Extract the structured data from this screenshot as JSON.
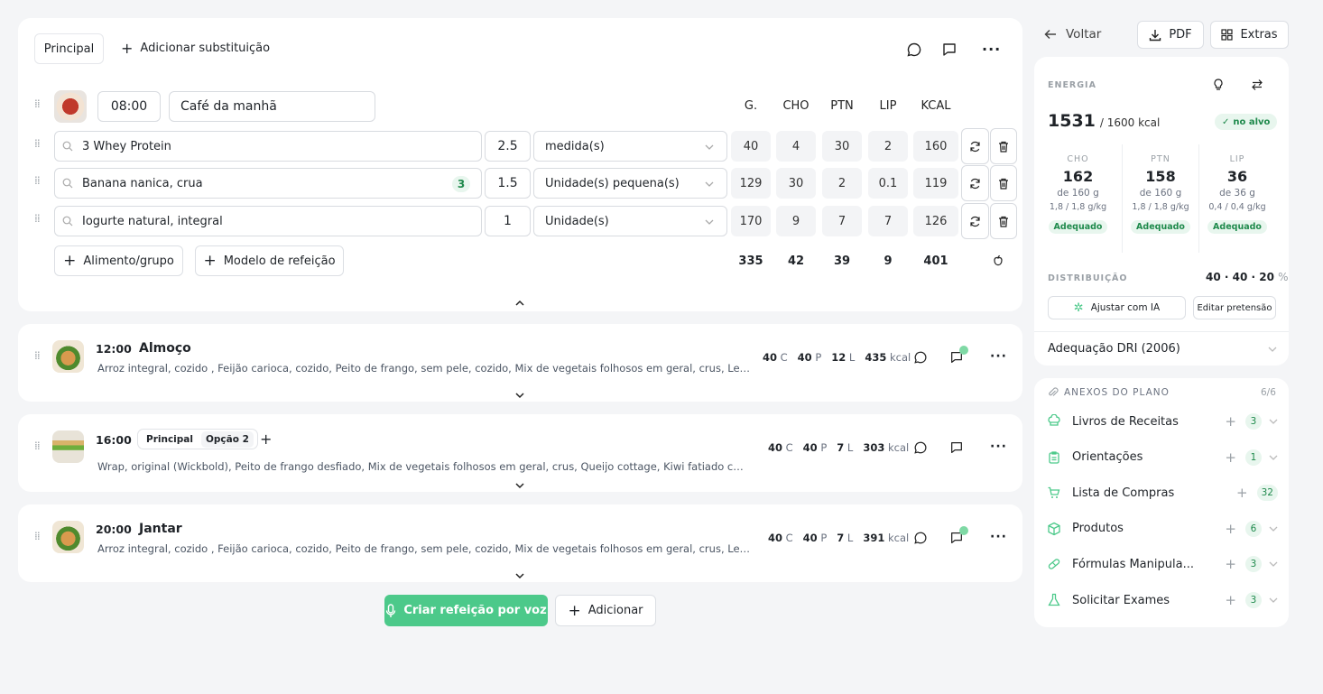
{
  "header": {
    "tab_principal": "Principal",
    "add_substitution": "Adicionar substituição"
  },
  "breakfast": {
    "time": "08:00",
    "name": "Café da manhã",
    "columns": [
      "G.",
      "CHO",
      "PTN",
      "LIP",
      "KCAL"
    ],
    "foods": [
      {
        "name": "3 Whey Protein",
        "badge": "",
        "qty": "2.5",
        "unit": "medida(s)",
        "g": "40",
        "cho": "4",
        "ptn": "30",
        "lip": "2",
        "kcal": "160"
      },
      {
        "name": "Banana nanica, crua",
        "badge": "3",
        "qty": "1.5",
        "unit": "Unidade(s) pequena(s)",
        "g": "129",
        "cho": "30",
        "ptn": "2",
        "lip": "0.1",
        "kcal": "119"
      },
      {
        "name": "Iogurte natural, integral",
        "badge": "",
        "qty": "1",
        "unit": "Unidade(s)",
        "g": "170",
        "cho": "9",
        "ptn": "7",
        "lip": "7",
        "kcal": "126"
      }
    ],
    "add_food": "Alimento/grupo",
    "meal_model": "Modelo de refeição",
    "totals": {
      "g": "335",
      "cho": "42",
      "ptn": "39",
      "lip": "9",
      "kcal": "401"
    }
  },
  "meals": [
    {
      "time": "12:00",
      "name": "Almoço",
      "desc": "Arroz integral, cozido , Feijão carioca, cozido, Peito de frango, sem pele, cozido, Mix de vegetais folhosos em geral, crus, Legumes, em geral, cozidos",
      "c": "40",
      "p": "40",
      "l": "12",
      "kcal": "435"
    },
    {
      "time": "16:00",
      "name": "",
      "opt1": "Principal",
      "opt2": "Opção 2",
      "desc": "Wrap, original (Wickbold), Peito de frango desfiado, Mix de vegetais folhosos em geral, crus, Queijo cottage, Kiwi fatiado com canela",
      "c": "40",
      "p": "40",
      "l": "7",
      "kcal": "303"
    },
    {
      "time": "20:00",
      "name": "Jantar",
      "desc": "Arroz integral, cozido , Feijão carioca, cozido, Peito de frango, sem pele, cozido, Mix de vegetais folhosos em geral, crus, Legumes, em geral, cozidos",
      "c": "40",
      "p": "40",
      "l": "7",
      "kcal": "391"
    }
  ],
  "macro_units": {
    "c": "C",
    "p": "P",
    "l": "L",
    "kcal": "kcal"
  },
  "actions": {
    "voice": "Criar refeição por voz",
    "add": "Adicionar"
  },
  "sidebar": {
    "back": "Voltar",
    "pdf": "PDF",
    "extras": "Extras",
    "energy_label": "ENERGIA",
    "energy_value": "1531",
    "energy_target": "/ 1600 kcal",
    "on_target": "no alvo",
    "macros": [
      {
        "label": "CHO",
        "value": "162",
        "of": "de 160 g",
        "ratio": "1,8 / 1,8 g/kg",
        "status": "Adequado"
      },
      {
        "label": "PTN",
        "value": "158",
        "of": "de 160 g",
        "ratio": "1,8 / 1,8 g/kg",
        "status": "Adequado"
      },
      {
        "label": "LIP",
        "value": "36",
        "of": "de 36 g",
        "ratio": "0,4 / 0,4 g/kg",
        "status": "Adequado"
      }
    ],
    "distribution_label": "DISTRIBUIÇÃO",
    "distribution_value": "40 · 40 · 20",
    "distribution_unit": "%",
    "adjust_ai": "Ajustar com IA",
    "edit_target": "Editar pretensão",
    "dri": "Adequação DRI (2006)",
    "annex_title": "ANEXOS DO PLANO",
    "annex_count": "6/6",
    "annexes": [
      {
        "label": "Livros de Receitas",
        "count": "3",
        "icon": "chef-hat-icon"
      },
      {
        "label": "Orientações",
        "count": "1",
        "icon": "clipboard-icon"
      },
      {
        "label": "Lista de Compras",
        "count": "32",
        "icon": "cart-icon"
      },
      {
        "label": "Produtos",
        "count": "6",
        "icon": "box-icon"
      },
      {
        "label": "Fórmulas Manipula...",
        "count": "3",
        "icon": "pill-icon"
      },
      {
        "label": "Solicitar Exames",
        "count": "3",
        "icon": "flask-icon"
      }
    ]
  },
  "colors": {
    "accent": "#4cc98a",
    "badge_bg": "#e8f6ee",
    "badge_fg": "#1f8a4c"
  }
}
